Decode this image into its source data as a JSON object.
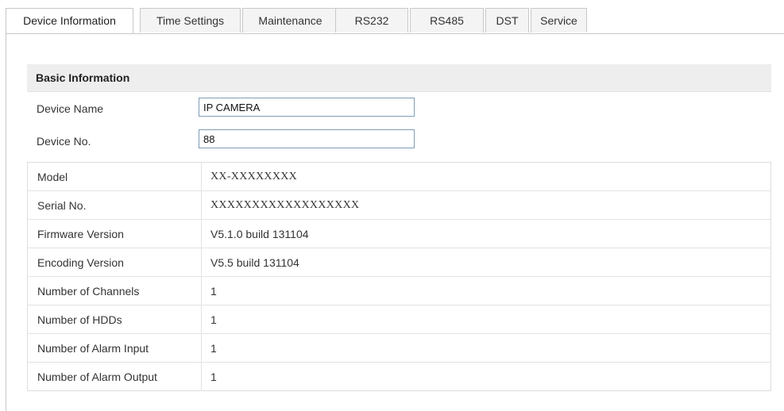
{
  "tabs": [
    {
      "label": "Device Information",
      "active": true
    },
    {
      "label": "Time Settings",
      "active": false
    },
    {
      "label": "Maintenance",
      "active": false
    },
    {
      "label": "RS232",
      "active": false
    },
    {
      "label": "RS485",
      "active": false
    },
    {
      "label": "DST",
      "active": false
    },
    {
      "label": "Service",
      "active": false
    }
  ],
  "basic": {
    "title": "Basic Information",
    "device_name_label": "Device Name",
    "device_name_value": "IP CAMERA",
    "device_no_label": "Device No.",
    "device_no_value": "88"
  },
  "info": [
    {
      "label": "Model",
      "value": "XX-XXXXXXXX"
    },
    {
      "label": "Serial No.",
      "value": "XXXXXXXXXXXXXXXXXX"
    },
    {
      "label": "Firmware Version",
      "value": "V5.1.0 build 131104"
    },
    {
      "label": "Encoding Version",
      "value": "V5.5 build 131104"
    },
    {
      "label": "Number of Channels",
      "value": "1"
    },
    {
      "label": "Number of HDDs",
      "value": "1"
    },
    {
      "label": "Number of Alarm Input",
      "value": "1"
    },
    {
      "label": "Number of Alarm Output",
      "value": "1"
    }
  ],
  "colors": {
    "tab_border": "#c8c8c8",
    "header_bg": "#eeeeee",
    "input_border": "#7f9db9"
  }
}
